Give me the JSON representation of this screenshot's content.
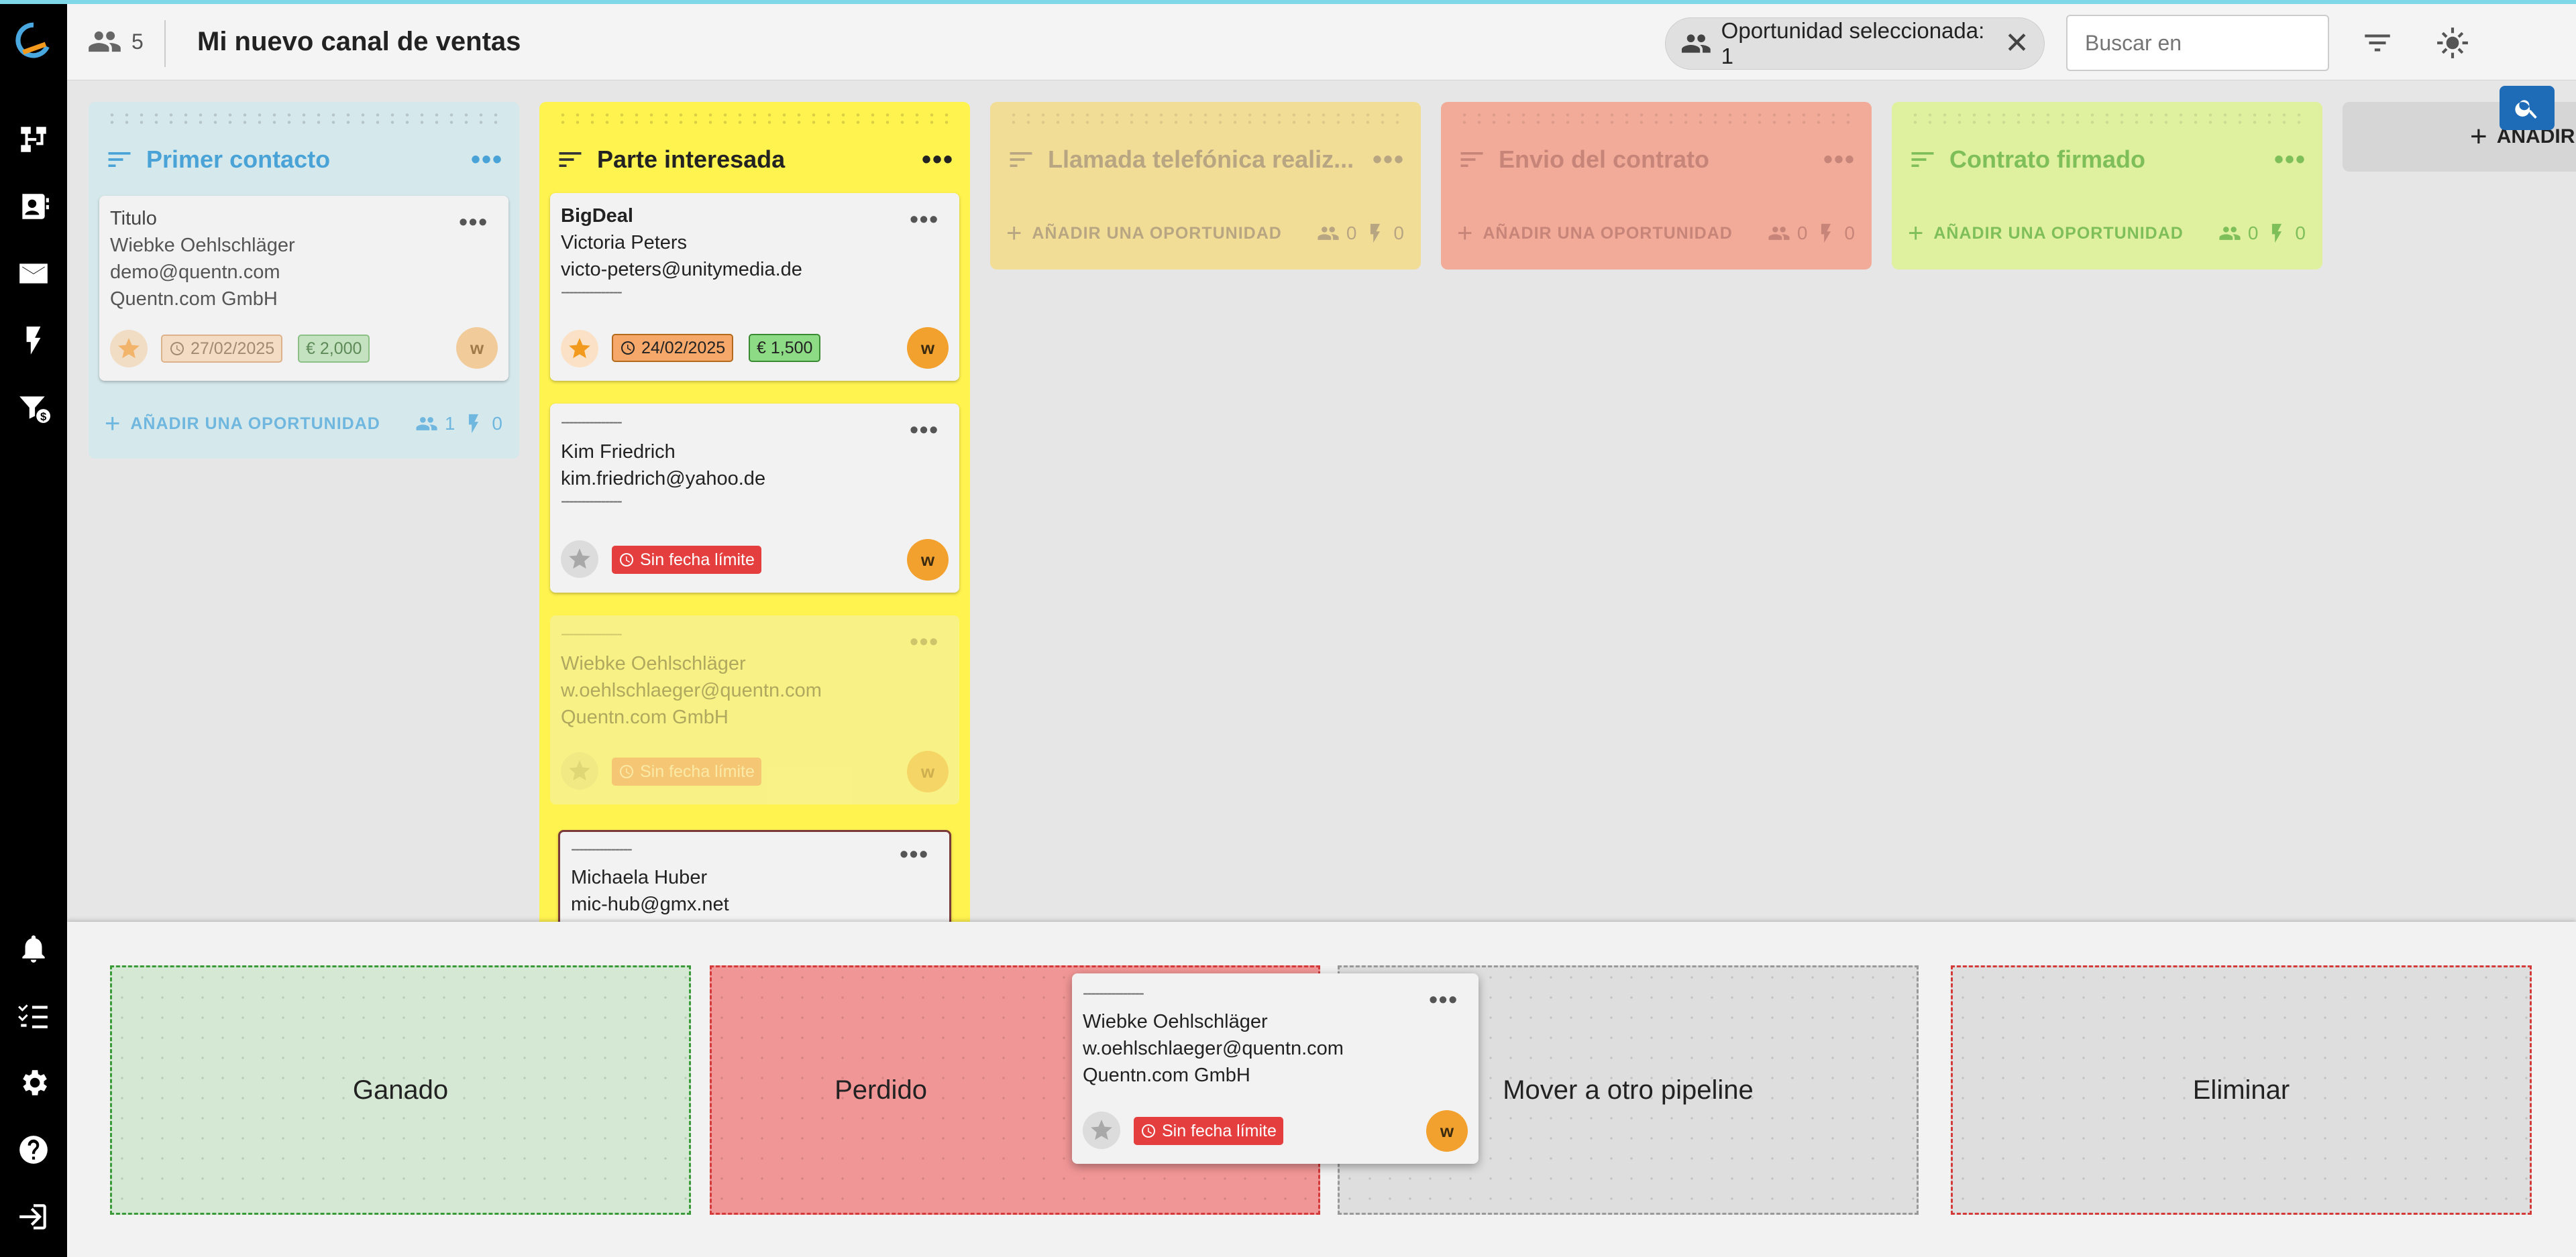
{
  "topbar": {
    "user_count": "5",
    "title": "Mi nuevo canal de ventas",
    "selection_chip": "Oportunidad seleccionada: 1",
    "search_placeholder": "Buscar en"
  },
  "colors": {
    "col1_bg": "#d5e8ec",
    "col1_fg": "#4aa3d6",
    "col2_bg": "#fff350",
    "col2_fg": "#222222",
    "col3_bg": "#f2dd97",
    "col3_fg": "#b8a683",
    "col4_bg": "#f2ab98",
    "col4_fg": "#c7857a",
    "col5_bg": "#dff09f",
    "col5_fg": "#7fbf5a"
  },
  "columns": [
    {
      "title": "Primer contacto",
      "add_label": "AÑADIR UNA OPORTUNIDAD",
      "people": "1",
      "actions": "0",
      "cards": [
        {
          "lines": [
            "Titulo",
            "Wiebke Oehlschläger",
            "demo@quentn.com",
            "Quentn.com GmbH"
          ],
          "date": "27/02/2025",
          "amount": "€ 2,000",
          "avatar": "w"
        }
      ]
    },
    {
      "title": "Parte interesada",
      "cards": [
        {
          "lines": [
            "BigDeal",
            "Victoria Peters",
            "victo-peters@unitymedia.de",
            "---------------"
          ],
          "date": "24/02/2025",
          "amount": "€ 1,500",
          "avatar": "w"
        },
        {
          "lines": [
            "---------------",
            "Kim Friedrich",
            "kim.friedrich@yahoo.de",
            "---------------"
          ],
          "no_due": "Sin fecha límite",
          "avatar": "w"
        },
        {
          "lines": [
            "---------------",
            "Wiebke Oehlschläger",
            "w.oehlschlaeger@quentn.com",
            "Quentn.com GmbH"
          ],
          "no_due": "Sin fecha límite",
          "avatar": "w"
        },
        {
          "lines": [
            "---------------",
            "Michaela Huber",
            "mic-hub@gmx.net"
          ]
        }
      ]
    },
    {
      "title": "Llamada telefónica realiz...",
      "add_label": "AÑADIR UNA OPORTUNIDAD",
      "people": "0",
      "actions": "0"
    },
    {
      "title": "Envio del contrato",
      "add_label": "AÑADIR UNA OPORTUNIDAD",
      "people": "0",
      "actions": "0"
    },
    {
      "title": "Contrato firmado",
      "add_label": "AÑADIR UNA OPORTUNIDAD",
      "people": "0",
      "actions": "0"
    }
  ],
  "add_stage_label": "AÑADIR",
  "drop_zones": {
    "won": "Ganado",
    "lost": "Perdido",
    "move": "Mover a otro pipeline",
    "delete": "Eliminar"
  },
  "dragged_card": {
    "lines": [
      "---------------",
      "Wiebke Oehlschläger",
      "w.oehlschlaeger@quentn.com",
      "Quentn.com GmbH"
    ],
    "no_due": "Sin fecha límite",
    "avatar": "w"
  }
}
